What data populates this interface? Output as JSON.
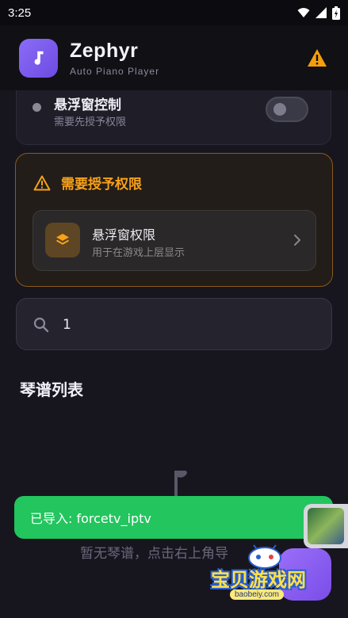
{
  "status_bar": {
    "time": "3:25",
    "icons": [
      "wifi-icon",
      "signal-icon",
      "battery-icon"
    ]
  },
  "header": {
    "app_name": "Zephyr",
    "app_subtitle": "Auto Piano Player",
    "logo_icon": "music-note-icon",
    "warning_icon": "warning-icon",
    "accent": "#7c5cf0"
  },
  "overlay_control": {
    "title": "悬浮窗控制",
    "subtitle": "需要先授予权限",
    "toggle_on": false
  },
  "permission_card": {
    "title": "需要授予权限",
    "border_color": "#8a5a17",
    "title_color": "#f7a11a",
    "item": {
      "title": "悬浮窗权限",
      "subtitle": "用于在游戏上层显示",
      "icon": "layers-icon",
      "chevron_icon": "chevron-right-icon"
    }
  },
  "search": {
    "value": "1",
    "icon": "search-icon"
  },
  "sheet_list": {
    "title": "琴谱列表",
    "empty_text": "暂无琴谱，点击右上角导",
    "empty_icon": "music-note-icon"
  },
  "toast": {
    "text": "已导入: forcetv_iptv",
    "color": "#22c55e"
  },
  "watermark": {
    "text": "宝贝游戏网",
    "url": "baobeiy.com"
  }
}
